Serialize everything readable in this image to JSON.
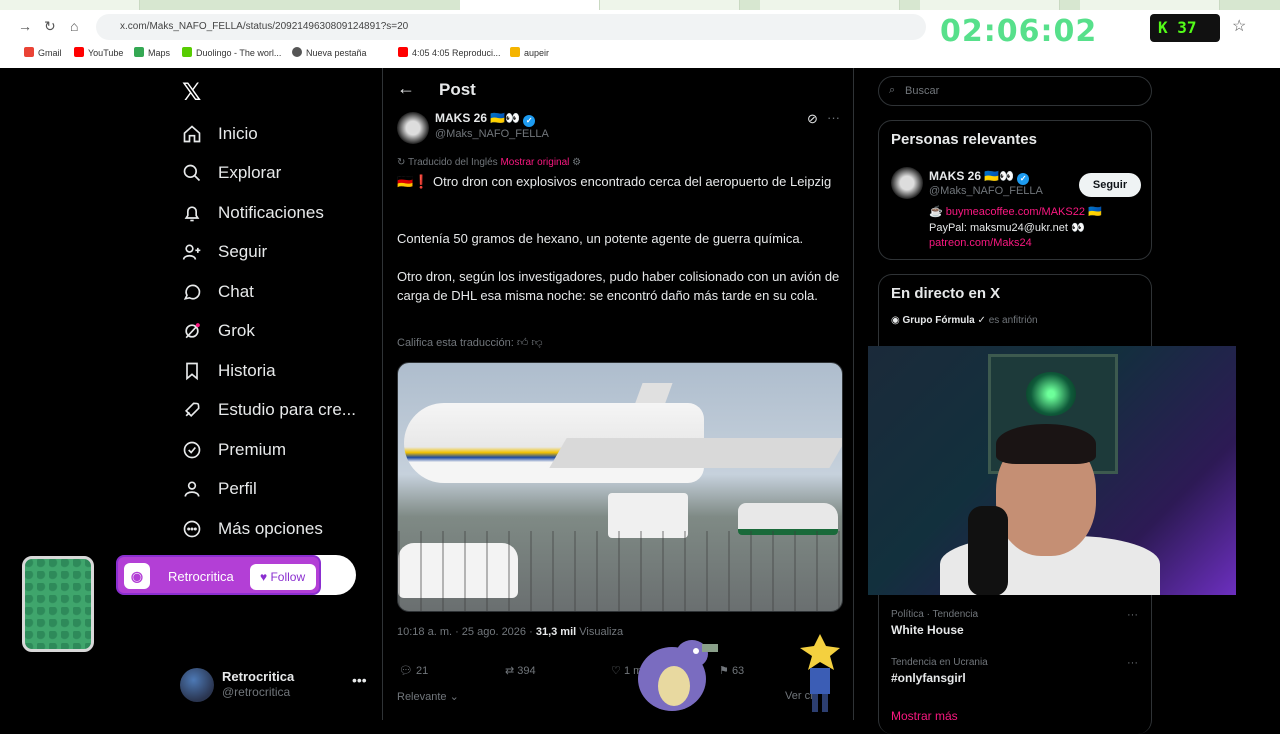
{
  "browser": {
    "url": "x.com/Maks_NAFO_FELLA/status/2092149630809124891?s=20",
    "timer": "02:06:02",
    "kick_count": "37",
    "bookmarks": [
      "Gmail",
      "YouTube",
      "Maps",
      "Duolingo - The worl...",
      "Nueva pestaña",
      "4:05 4:05 Reproduci...",
      "aupeir"
    ]
  },
  "sidebar": {
    "items": [
      {
        "label": "Inicio",
        "icon": "home-icon"
      },
      {
        "label": "Explorar",
        "icon": "search-icon"
      },
      {
        "label": "Notificaciones",
        "icon": "bell-icon"
      },
      {
        "label": "Seguir",
        "icon": "follow-icon"
      },
      {
        "label": "Chat",
        "icon": "chat-icon"
      },
      {
        "label": "Grok",
        "icon": "grok-icon"
      },
      {
        "label": "Historia",
        "icon": "bookmark-icon"
      },
      {
        "label": "Estudio para cre...",
        "icon": "rocket-icon"
      },
      {
        "label": "Premium",
        "icon": "premium-icon"
      },
      {
        "label": "Perfil",
        "icon": "person-icon"
      },
      {
        "label": "Más opciones",
        "icon": "more-circle-icon"
      }
    ],
    "user": {
      "name": "Retrocritica",
      "handle": "@retrocritica"
    }
  },
  "post": {
    "header_title": "Post",
    "author_name": "MAKS 26 🇺🇦👀",
    "author_handle": "@Maks_NAFO_FELLA",
    "translated_label": "Traducido del Inglés",
    "show_original": "Mostrar original",
    "text1": "🇩🇪❗ Otro dron con explosivos encontrado cerca del aeropuerto de Leipzig",
    "text2": "Contenía 50 gramos de hexano, un potente agente de guerra química.",
    "text3": "Otro dron, según los investigadores, pudo haber colisionado con un avión de carga de DHL esa misma noche: se encontró daño más tarde en su cola.",
    "rate_translation": "Califica esta traducción:",
    "timestamp": "10:18 a. m. · 25 ago. 2026 ·",
    "views_count": "31,3 mil",
    "views_label": "Visualiza",
    "replies": "21",
    "reposts": "394",
    "likes": "1 m",
    "bookmarks": "63",
    "relevant_label": "Relevante",
    "view_quotes": "Ver cit"
  },
  "right": {
    "search_placeholder": "Buscar",
    "relevant_people": "Personas relevantes",
    "person_name": "MAKS 26 🇺🇦👀",
    "person_handle": "@Maks_NAFO_FELLA",
    "follow_label": "Seguir",
    "bio_link1": "buymeacoffee.com/MAKS22",
    "bio_line2": "PayPal: maksmu24@ukr.net 👀",
    "bio_link3": "patreon.com/Maks24",
    "live_title": "En directo en X",
    "live_host": "Grupo Fórmula",
    "live_host_suffix": "es anfitrión",
    "trends": [
      {
        "category": "Política · Tendencia",
        "title": "White House"
      },
      {
        "category": "Tendencia en Ucrania",
        "title": "#onlyfansgirl"
      }
    ],
    "show_more": "Mostrar más"
  },
  "overlay": {
    "discord_name": "Retrocritica",
    "discord_follow": "Follow"
  },
  "colors": {
    "accent": "#f91880",
    "verified": "#1d9bf0",
    "timer": "#57e08b",
    "discord": "#b33fd6"
  }
}
